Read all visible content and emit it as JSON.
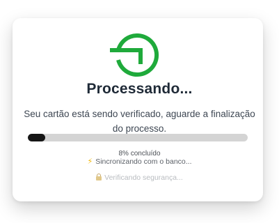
{
  "dialog": {
    "icon": "payment-processing-logo-icon",
    "title": "Processando...",
    "message": "Seu cartão está sendo verificado, aguarde a finalização do processo.",
    "progress": {
      "percent": 8,
      "label": "8% concluído"
    },
    "steps": [
      {
        "icon": "lightning-bolt-icon",
        "text": "Sincronizando com o banco...",
        "state": "active"
      },
      {
        "icon": "lock-icon",
        "text": "Verificando segurança...",
        "state": "pending"
      }
    ]
  },
  "colors": {
    "accent_green": "#1faa3b",
    "progress_fill": "#161616",
    "progress_track": "#d4d4d4",
    "title": "#1f2a37"
  }
}
